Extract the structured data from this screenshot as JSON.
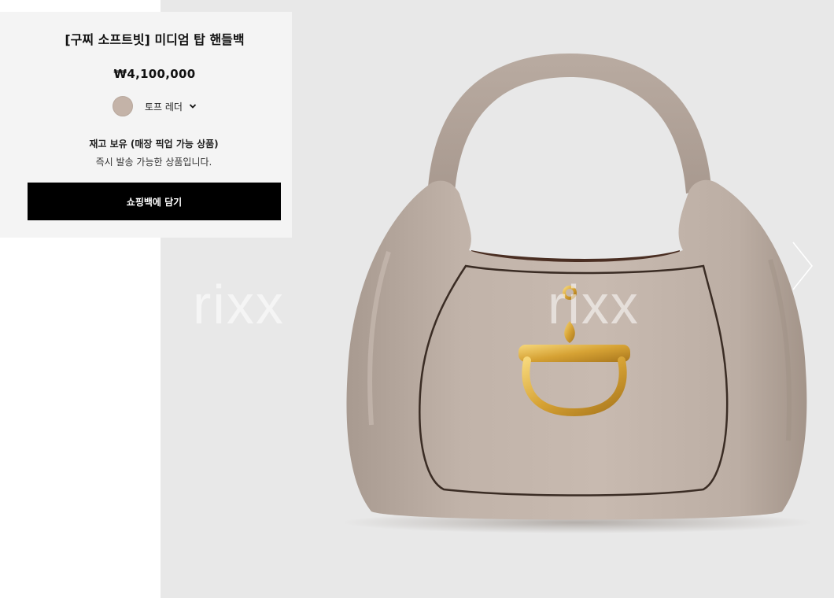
{
  "product": {
    "title": "[구찌 소프트빗] 미디엄 탑 핸들백",
    "price": "₩4,100,000",
    "color": {
      "label": "토프 레더",
      "swatch": "#c4b3a8"
    },
    "stock": {
      "title": "재고 보유 (매장 픽업 가능 상품)",
      "subtitle": "즉시 발송 가능한 상품입니다."
    },
    "add_to_cart_label": "쇼핑백에 담기"
  },
  "gallery": {
    "watermark": "rixx",
    "next_icon": "chevron-right-icon"
  },
  "colors": {
    "accent": "#000000",
    "panel": "#f4f4f4",
    "stage": "#e8e8e8"
  }
}
